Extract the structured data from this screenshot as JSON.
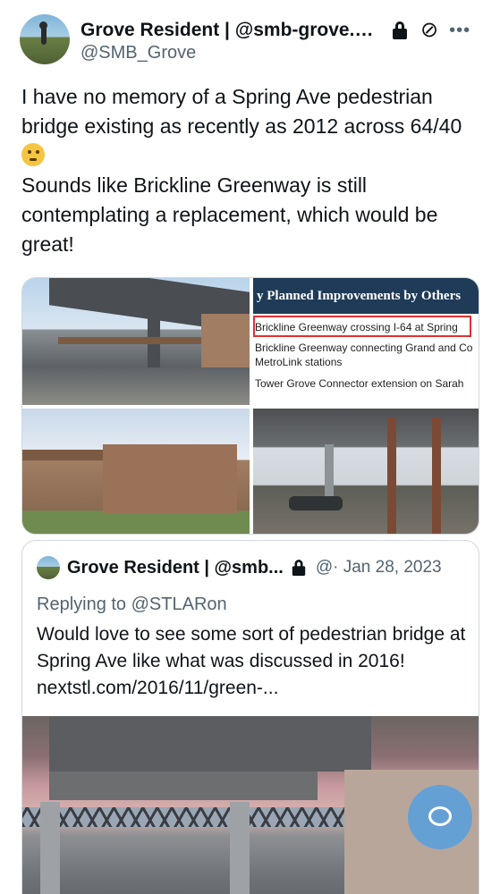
{
  "post": {
    "display_name": "Grove Resident | @smb-grove.bs...",
    "handle": "@SMB_Grove",
    "icons": {
      "lock": "lock-icon",
      "grok": "grok-icon",
      "more": "more-icon"
    },
    "text_lines": [
      "I have no memory of a Spring Ave pedestrian bridge existing as recently as 2012 across 64/40",
      "Sounds like Brickline Greenway is still contemplating a replacement, which would be great!"
    ]
  },
  "media": {
    "slide_title": "y Planned Improvements by Others",
    "slide_items": [
      "Brickline Greenway crossing I-64 at Spring",
      "Brickline Greenway connecting Grand and Co",
      "MetroLink stations",
      "Tower Grove Connector extension on Sarah"
    ],
    "highlight_color": "#e03131"
  },
  "quoted": {
    "display_name": "Grove Resident | @smb...",
    "meta": "@· Jan 28, 2023",
    "replying_to": "Replying to @STLARon",
    "text": "Would love to see some sort of pedestrian bridge at Spring Ave like what was discussed in 2016!",
    "link": "nextstl.com/2016/11/green-..."
  },
  "accent": "#1d9bf0"
}
